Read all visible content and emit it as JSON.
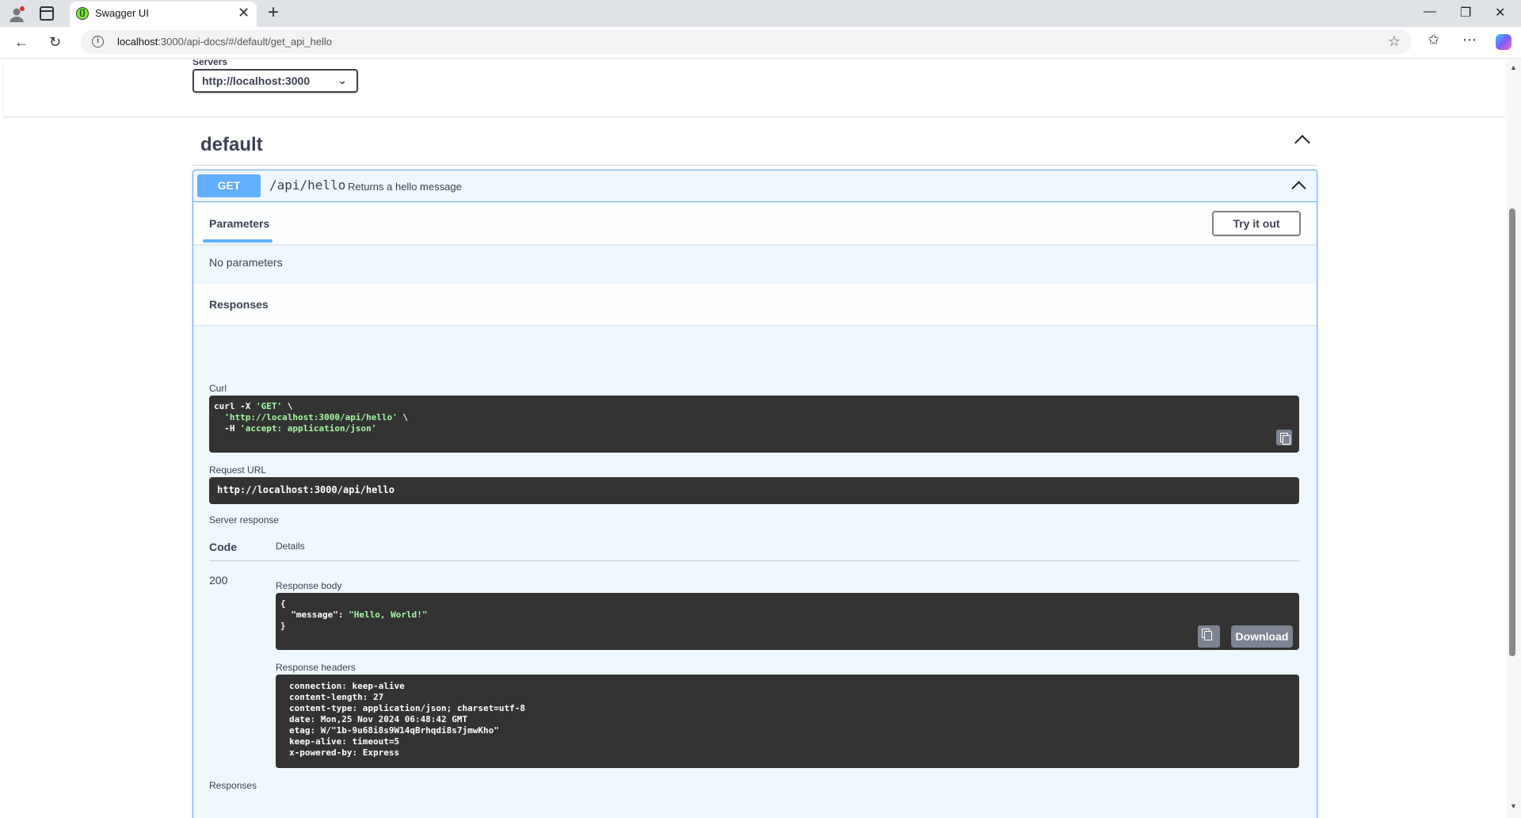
{
  "browser": {
    "tab_title": "Swagger UI",
    "url_host": "localhost",
    "url_rest": ":3000/api-docs/#/default/get_api_hello"
  },
  "servers": {
    "label": "Servers",
    "selected": "http://localhost:3000"
  },
  "tag": {
    "name": "default"
  },
  "operation": {
    "method": "GET",
    "path": "/api/hello",
    "summary": "Returns a hello message",
    "parameters_tab": "Parameters",
    "try_it_out": "Try it out",
    "no_parameters": "No parameters",
    "responses_title": "Responses"
  },
  "execution": {
    "curl_label": "Curl",
    "curl_lines": [
      {
        "pre": "curl -X ",
        "str": "'GET'",
        "post": " \\"
      },
      {
        "pre": "  ",
        "str": "'http://localhost:3000/api/hello'",
        "post": " \\"
      },
      {
        "pre": "  -H ",
        "str": "'accept: application/json'",
        "post": ""
      }
    ],
    "request_url_label": "Request URL",
    "request_url": "http://localhost:3000/api/hello",
    "server_response_label": "Server response",
    "code_header": "Code",
    "details_header": "Details",
    "code": "200",
    "response_body_label": "Response body",
    "body_open": "{",
    "body_key": "\"message\"",
    "body_value": "\"Hello, World!\"",
    "body_close": "}",
    "download_label": "Download",
    "response_headers_label": "Response headers",
    "response_headers": [
      "connection: keep-alive",
      "content-length: 27",
      "content-type: application/json; charset=utf-8",
      "date: Mon,25 Nov 2024 06:48:42 GMT",
      "etag: W/\"1b-9u68i8s9W14qBrhqdi8s7jmwKho\"",
      "keep-alive: timeout=5",
      "x-powered-by: Express"
    ],
    "bottom_responses_label": "Responses"
  }
}
